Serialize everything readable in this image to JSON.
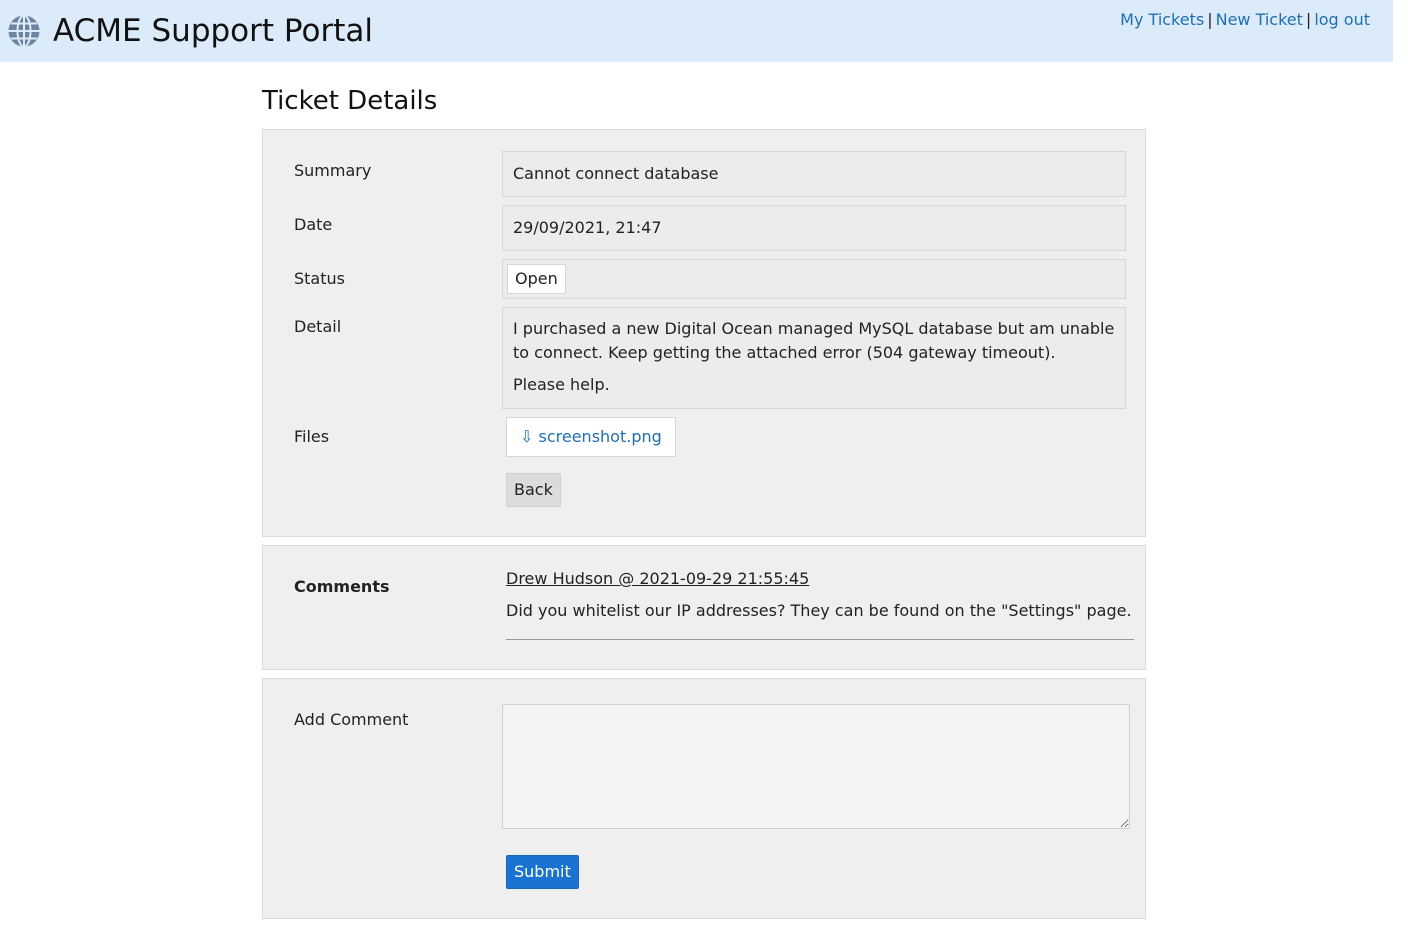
{
  "header": {
    "icon": "globe-icon",
    "title": "ACME Support Portal",
    "nav": {
      "my_tickets": "My Tickets",
      "separator": "|",
      "new_ticket": "New Ticket",
      "log_out": "log out"
    }
  },
  "page": {
    "title": "Ticket Details"
  },
  "ticket": {
    "summary_label": "Summary",
    "summary": "Cannot connect database",
    "date_label": "Date",
    "date": "29/09/2021, 21:47",
    "status_label": "Status",
    "status": "Open",
    "detail_label": "Detail",
    "detail_lines": [
      "I purchased a new Digital Ocean managed MySQL database but am unable to connect. Keep getting the attached error (504 gateway timeout).",
      "Please help."
    ],
    "files_label": "Files",
    "file_icon": "download-arrow-icon",
    "file_glyph": "⇩",
    "file_name": "screenshot.png",
    "back_label": "Back"
  },
  "comments": {
    "label": "Comments",
    "items": [
      {
        "author_line": "Drew Hudson @ 2021-09-29 21:55:45",
        "text": "Did you whitelist our IP addresses? They can be found on the \"Settings\" page."
      }
    ]
  },
  "add_comment": {
    "label": "Add Comment",
    "value": "",
    "submit_label": "Submit"
  },
  "colors": {
    "header_bg": "#dcebfa",
    "link": "#1f6fb2",
    "panel_bg": "#efefef",
    "submit_bg": "#1a73d0"
  }
}
